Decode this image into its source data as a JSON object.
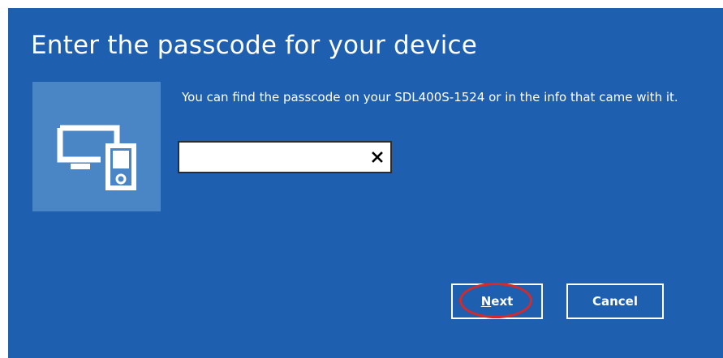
{
  "dialog": {
    "title": "Enter the passcode for your device",
    "instructions": "You can find the passcode on your SDL400S-1524 or in the info that came with it.",
    "device_icon": "devices-icon",
    "passcode": {
      "value": "",
      "placeholder": "",
      "clear_label": "✕",
      "clear_icon": "close-icon"
    },
    "buttons": {
      "next_access_key": "N",
      "next_rest": "ext",
      "cancel_label": "Cancel"
    }
  },
  "colors": {
    "background": "#1e5fb0",
    "tile": "#4a86c6",
    "highlight": "#d42a2a"
  }
}
